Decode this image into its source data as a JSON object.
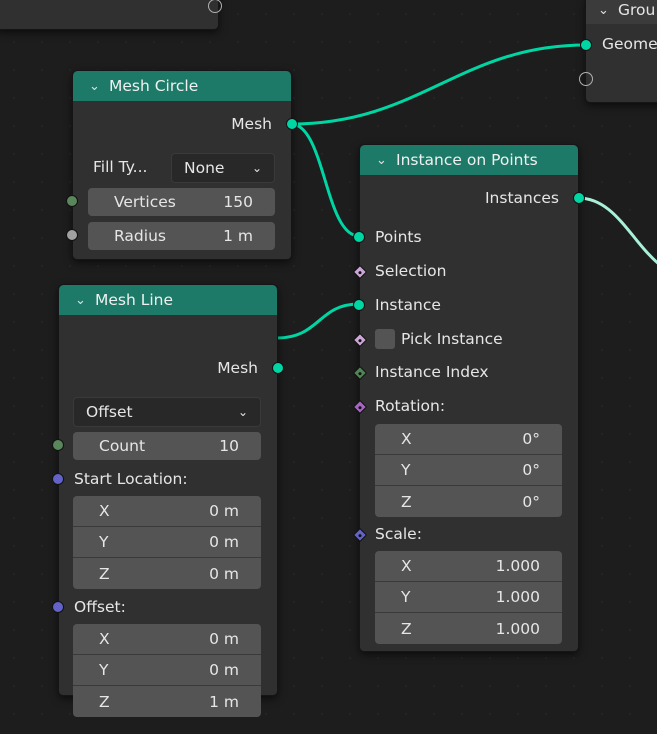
{
  "group_output": {
    "title": "Grou",
    "socket_label": "Geome"
  },
  "mesh_circle": {
    "title": "Mesh Circle",
    "output_label": "Mesh",
    "fill_type_label": "Fill Ty...",
    "fill_type_value": "None",
    "vertices_label": "Vertices",
    "vertices_value": "150",
    "radius_label": "Radius",
    "radius_value": "1 m"
  },
  "mesh_line": {
    "title": "Mesh Line",
    "output_label": "Mesh",
    "mode_value": "Offset",
    "count_label": "Count",
    "count_value": "10",
    "start_location_label": "Start Location:",
    "start_location": [
      {
        "axis": "X",
        "value": "0 m"
      },
      {
        "axis": "Y",
        "value": "0 m"
      },
      {
        "axis": "Z",
        "value": "0 m"
      }
    ],
    "offset_label": "Offset:",
    "offset": [
      {
        "axis": "X",
        "value": "0 m"
      },
      {
        "axis": "Y",
        "value": "0 m"
      },
      {
        "axis": "Z",
        "value": "1 m"
      }
    ]
  },
  "instance_on_points": {
    "title": "Instance on Points",
    "output_label": "Instances",
    "points_label": "Points",
    "selection_label": "Selection",
    "instance_label": "Instance",
    "pick_instance_label": "Pick Instance",
    "instance_index_label": "Instance Index",
    "rotation_label": "Rotation:",
    "rotation": [
      {
        "axis": "X",
        "value": "0°"
      },
      {
        "axis": "Y",
        "value": "0°"
      },
      {
        "axis": "Z",
        "value": "0°"
      }
    ],
    "scale_label": "Scale:",
    "scale": [
      {
        "axis": "X",
        "value": "1.000"
      },
      {
        "axis": "Y",
        "value": "1.000"
      },
      {
        "axis": "Z",
        "value": "1.000"
      }
    ]
  },
  "icons": {
    "collapse": "chevron-down-icon",
    "dropdown": "chevron-down-icon"
  },
  "colors": {
    "header": "#1e7a68",
    "geometry_socket": "#00d6a3",
    "integer_socket": "#59865a",
    "float_socket": "#a1a1a1",
    "vector_socket": "#6363c7",
    "boolean_socket": "#cca6d6",
    "rotation_socket": "#a565c0",
    "wire": "#00d6a3",
    "output_wire": "#a8f0d8"
  }
}
